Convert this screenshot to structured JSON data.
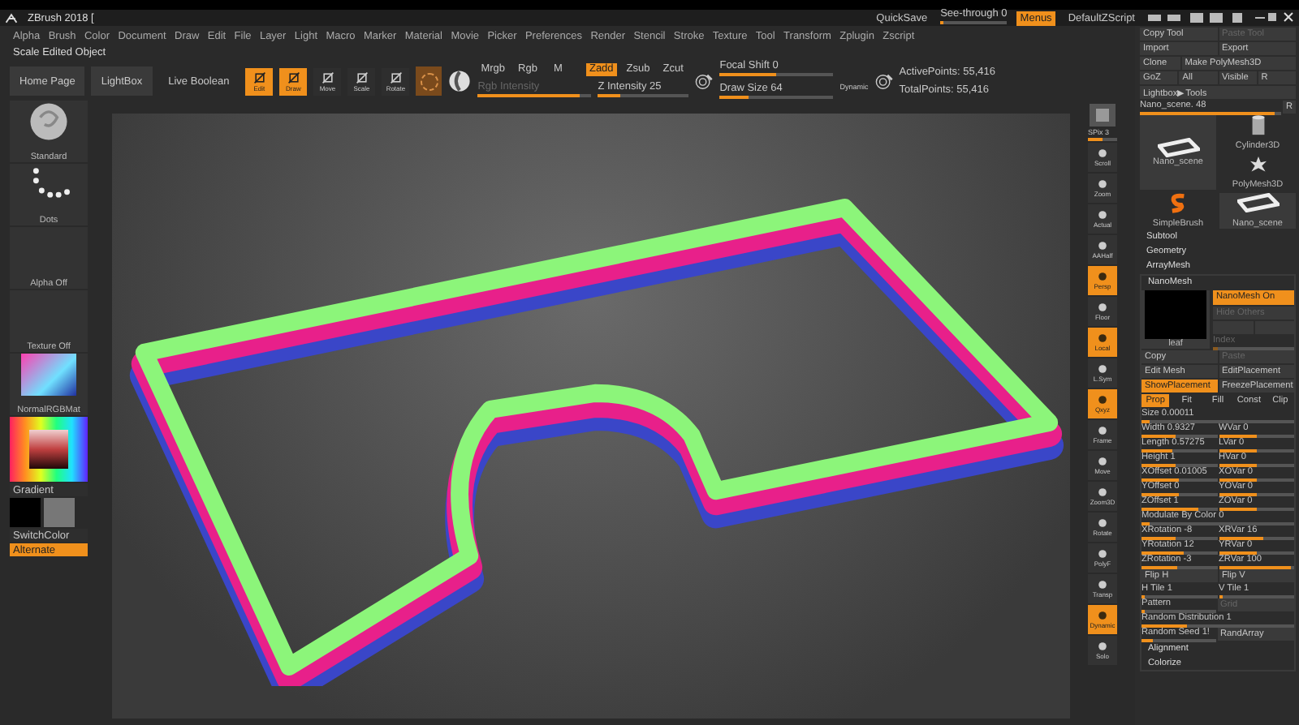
{
  "title": "ZBrush 2018 [",
  "top_right": {
    "quicksave": "QuickSave",
    "see_through": {
      "label": "See-through 0",
      "level": 0.05
    },
    "menus": {
      "label": "Menus",
      "on": true
    },
    "script": "DefaultZScript"
  },
  "menu": [
    "Alpha",
    "Brush",
    "Color",
    "Document",
    "Draw",
    "Edit",
    "File",
    "Layer",
    "Light",
    "Macro",
    "Marker",
    "Material",
    "Movie",
    "Picker",
    "Preferences",
    "Render",
    "Stencil",
    "Stroke",
    "Texture",
    "Tool",
    "Transform",
    "Zplugin",
    "Zscript"
  ],
  "hint": "Scale Edited Object",
  "toolbar": {
    "buttons": [
      "Home Page",
      "LightBox",
      "Live Boolean"
    ],
    "modes": [
      {
        "label": "Edit",
        "selected": true
      },
      {
        "label": "Draw",
        "selected": true
      },
      {
        "label": "Move",
        "selected": false
      },
      {
        "label": "Scale",
        "selected": false
      },
      {
        "label": "Rotate",
        "selected": false
      }
    ],
    "channels": [
      {
        "label": "Mrgb",
        "on": false
      },
      {
        "label": "Rgb",
        "on": false
      },
      {
        "label": "M",
        "on": false
      },
      {
        "label": "Zadd",
        "on": true
      },
      {
        "label": "Zsub",
        "on": false
      },
      {
        "label": "Zcut",
        "on": false
      }
    ],
    "rgb_intensity": {
      "label": "Rgb Intensity",
      "level": 0.9
    },
    "z_intensity": {
      "label": "Z Intensity 25",
      "level": 0.25
    },
    "focal_shift": {
      "label": "Focal Shift 0",
      "level": 0.5
    },
    "draw_size": {
      "label": "Draw Size 64",
      "level": 0.25
    },
    "dynamic": "Dynamic",
    "active_points": "ActivePoints: 55,416",
    "total_points": "TotalPoints: 55,416"
  },
  "shelf": {
    "items": [
      {
        "label": "Standard",
        "kind": "brush"
      },
      {
        "label": "Dots",
        "kind": "stroke"
      },
      {
        "label": "Alpha Off",
        "kind": "blank"
      },
      {
        "label": "Texture Off",
        "kind": "blank"
      },
      {
        "label": "NormalRGBMat",
        "kind": "material"
      }
    ],
    "gradient": "Gradient",
    "switch_color": "SwitchColor",
    "alternate": {
      "label": "Alternate",
      "on": true
    }
  },
  "spix": {
    "label": "SPix 3",
    "level": 0.5
  },
  "view_buttons": [
    {
      "label": "Scroll",
      "selected": false
    },
    {
      "label": "Zoom",
      "selected": false
    },
    {
      "label": "Actual",
      "selected": false
    },
    {
      "label": "AAHalf",
      "selected": false
    },
    {
      "label": "Persp",
      "selected": true
    },
    {
      "label": "Floor",
      "selected": false
    },
    {
      "label": "Local",
      "selected": true
    },
    {
      "label": "L.Sym",
      "selected": false
    },
    {
      "label": "Qxyz",
      "selected": true
    },
    {
      "label": "Frame",
      "selected": false
    },
    {
      "label": "Move",
      "selected": false
    },
    {
      "label": "Zoom3D",
      "selected": false
    },
    {
      "label": "Rotate",
      "selected": false
    },
    {
      "label": "PolyF",
      "selected": false
    },
    {
      "label": "Transp",
      "selected": false
    },
    {
      "label": "Dynamic",
      "selected": true
    },
    {
      "label": "Solo",
      "selected": false
    }
  ],
  "palette": {
    "buttons": [
      [
        {
          "label": "Copy Tool",
          "disabled": false
        },
        {
          "label": "Paste Tool",
          "disabled": true
        }
      ],
      [
        {
          "label": "Import",
          "disabled": false
        },
        {
          "label": "Export",
          "disabled": false
        }
      ],
      [
        {
          "label": "Clone",
          "disabled": false
        },
        {
          "label": "Make PolyMesh3D",
          "disabled": false
        }
      ],
      [
        {
          "label": "GoZ",
          "disabled": false
        },
        {
          "label": "All",
          "disabled": false
        },
        {
          "label": "Visible",
          "disabled": false
        },
        {
          "label": "R",
          "disabled": false
        }
      ]
    ],
    "lightbox": "Lightbox▶Tools",
    "current_tool": {
      "label": "Nano_scene. 48",
      "level": 0.95,
      "reset": "R"
    },
    "tools": [
      {
        "label": "Cylinder3D",
        "kind": "cylinder"
      },
      {
        "label": "Nano_scene",
        "kind": "frame"
      },
      {
        "label": "PolyMesh3D",
        "kind": "star"
      },
      {
        "label": "SimpleBrush",
        "kind": "brush"
      },
      {
        "label": "Nano_scene",
        "kind": "frame"
      }
    ],
    "sections": [
      "Subtool",
      "Geometry",
      "ArrayMesh"
    ],
    "nanomesh": {
      "title": "NanoMesh",
      "thumb": "leaf",
      "nanomesh_on": {
        "label": "NanoMesh On",
        "on": true
      },
      "hide_others": "Hide Others",
      "index": {
        "label": "Index",
        "level": 0.05
      },
      "pairs": [
        [
          {
            "label": "Copy",
            "on": false,
            "disabled": false
          },
          {
            "label": "Paste",
            "on": false,
            "disabled": true
          }
        ],
        [
          {
            "label": "Edit Mesh",
            "on": false,
            "disabled": false
          },
          {
            "label": "EditPlacement",
            "on": false,
            "disabled": false
          }
        ],
        [
          {
            "label": "ShowPlacement",
            "on": true,
            "disabled": false
          },
          {
            "label": "FreezePlacement",
            "on": false,
            "disabled": false
          }
        ]
      ],
      "tabs": [
        {
          "label": "Prop",
          "selected": true
        },
        {
          "label": "Fit",
          "selected": false
        },
        {
          "label": "Fill",
          "selected": false
        },
        {
          "label": "Const",
          "selected": false
        },
        {
          "label": "Clip",
          "selected": false
        }
      ],
      "rows": [
        {
          "cells": [
            {
              "label": "Size 0.00011",
              "kind": "slider",
              "level": 0.05
            }
          ]
        },
        {
          "cells": [
            {
              "label": "Width 0.9327",
              "kind": "slider",
              "level": 0.45
            },
            {
              "label": "WVar 0",
              "kind": "slider",
              "level": 0.5
            }
          ]
        },
        {
          "cells": [
            {
              "label": "Length 0.57275",
              "kind": "slider",
              "level": 0.4
            },
            {
              "label": "LVar 0",
              "kind": "slider",
              "level": 0.5
            }
          ]
        },
        {
          "cells": [
            {
              "label": "Height 1",
              "kind": "slider",
              "level": 0.45
            },
            {
              "label": "HVar 0",
              "kind": "slider",
              "level": 0.5
            }
          ]
        },
        {
          "cells": [
            {
              "label": "XOffset 0.01005",
              "kind": "slider",
              "level": 0.5
            },
            {
              "label": "XOVar 0",
              "kind": "slider",
              "level": 0.5
            }
          ]
        },
        {
          "cells": [
            {
              "label": "YOffset 0",
              "kind": "slider",
              "level": 0.5
            },
            {
              "label": "YOVar 0",
              "kind": "slider",
              "level": 0.5
            }
          ]
        },
        {
          "cells": [
            {
              "label": "ZOffset 1",
              "kind": "slider",
              "level": 0.75
            },
            {
              "label": "ZOVar 0",
              "kind": "slider",
              "level": 0.5
            }
          ]
        },
        {
          "cells": [
            {
              "label": "Modulate By Color 0",
              "kind": "slider",
              "level": 0.05
            }
          ]
        },
        {
          "cells": [
            {
              "label": "XRotation -8",
              "kind": "slider",
              "level": 0.45
            },
            {
              "label": "XRVar 16",
              "kind": "slider",
              "level": 0.6
            }
          ]
        },
        {
          "cells": [
            {
              "label": "YRotation 12",
              "kind": "slider",
              "level": 0.55
            },
            {
              "label": "YRVar 0",
              "kind": "slider",
              "level": 0.5
            }
          ]
        },
        {
          "cells": [
            {
              "label": "ZRotation -3",
              "kind": "slider",
              "level": 0.48
            },
            {
              "label": "ZRVar 100",
              "kind": "slider",
              "level": 0.95
            }
          ]
        },
        {
          "cells": [
            {
              "label": "Flip H",
              "kind": "button",
              "disabled": false
            },
            {
              "label": "Flip V",
              "kind": "button",
              "disabled": false
            }
          ]
        },
        {
          "cells": [
            {
              "label": "H Tile 1",
              "kind": "slider",
              "level": 0.05
            },
            {
              "label": "V Tile 1",
              "kind": "slider",
              "level": 0.05
            }
          ]
        },
        {
          "cells": [
            {
              "label": "Pattern",
              "kind": "slider",
              "level": 0.05
            },
            {
              "label": "Grid",
              "kind": "button",
              "disabled": true
            }
          ]
        },
        {
          "cells": [
            {
              "label": "Random Distribution 1",
              "kind": "slider",
              "level": 0.3
            }
          ]
        },
        {
          "cells": [
            {
              "label": "Random Seed 1!",
              "kind": "slider",
              "level": 0.15
            },
            {
              "label": "RandArray",
              "kind": "button",
              "disabled": false
            }
          ]
        }
      ]
    },
    "bottom_sections": [
      "Alignment",
      "Colorize"
    ]
  }
}
